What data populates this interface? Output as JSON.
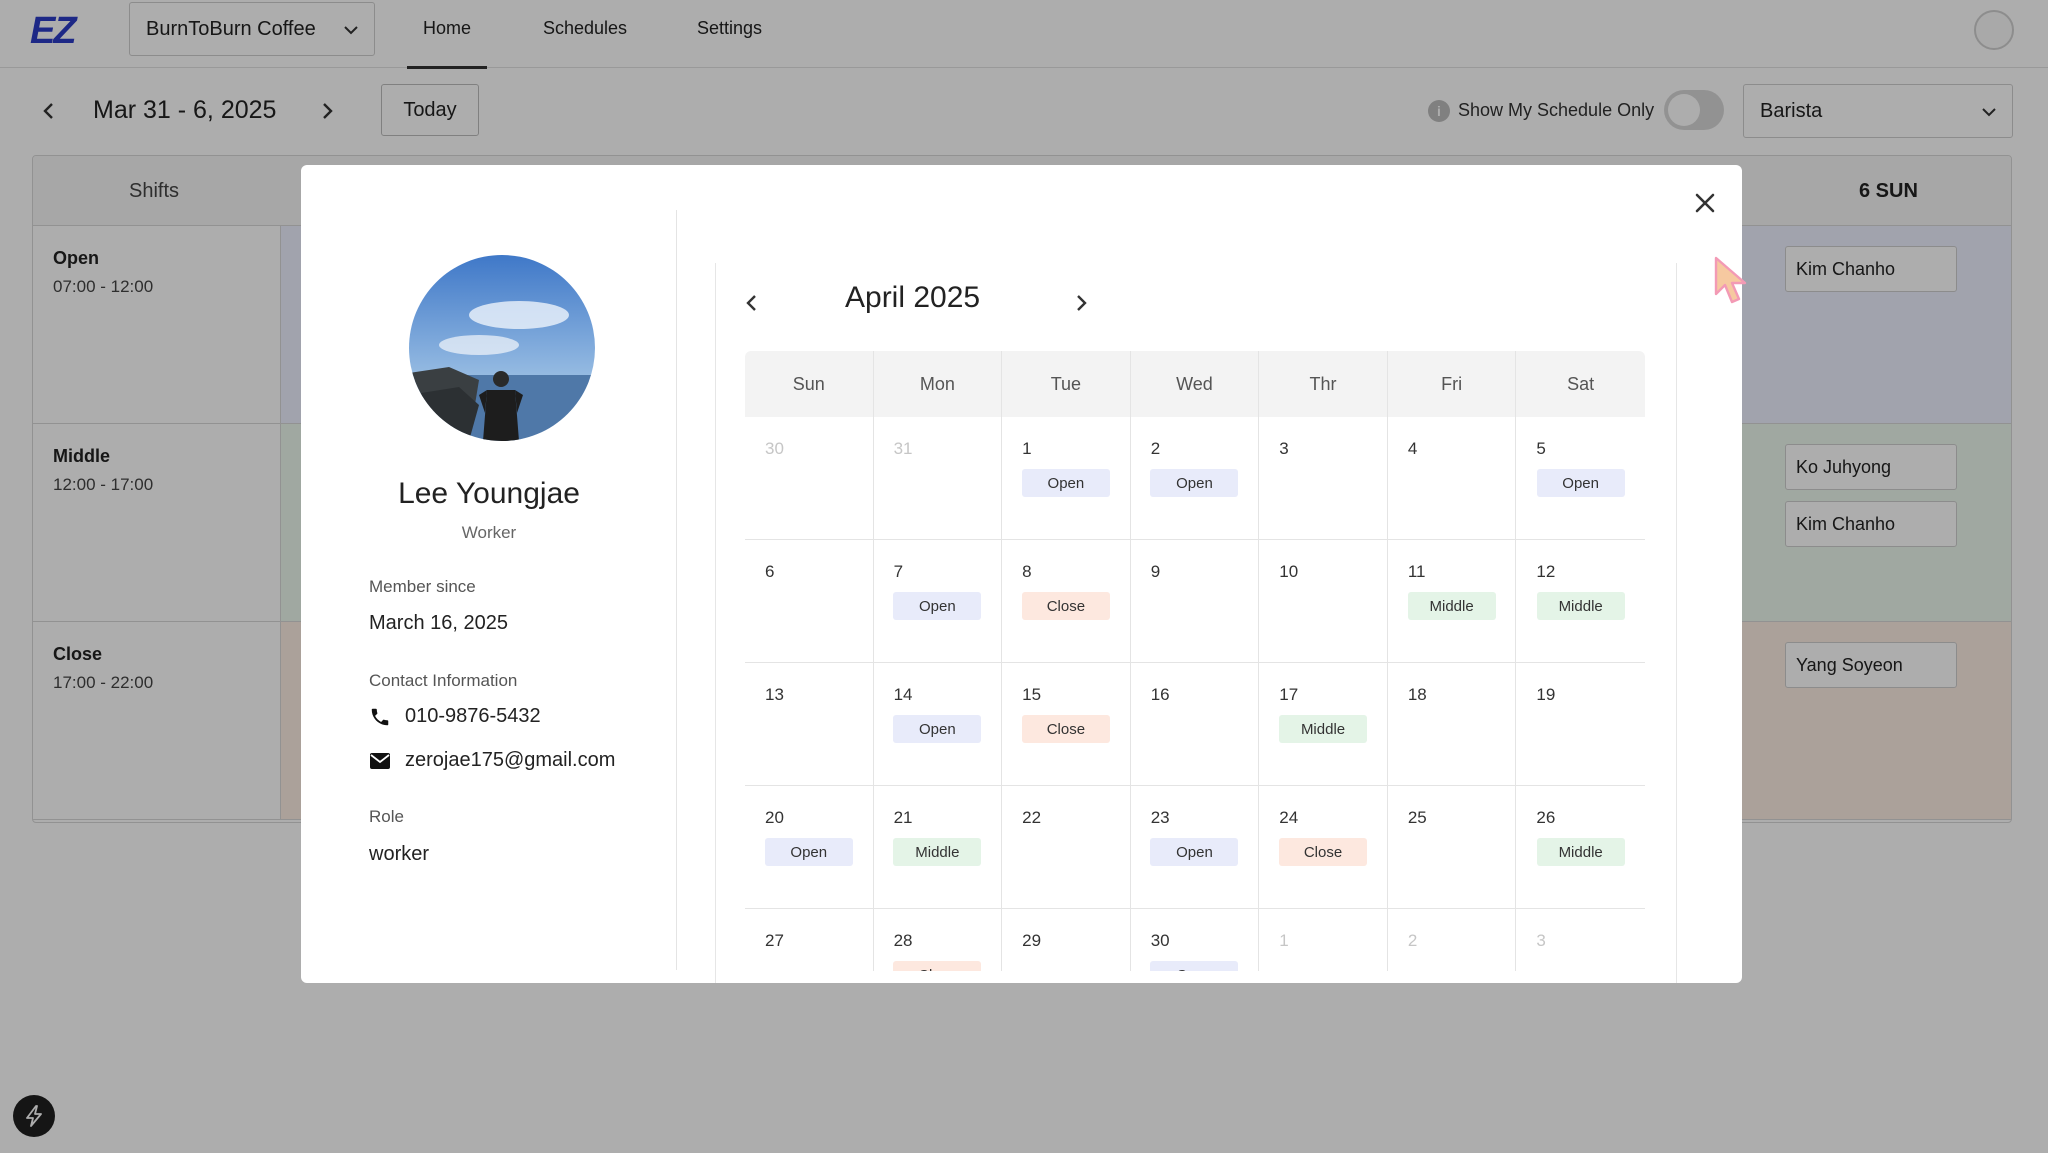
{
  "app": {
    "logo": "EZ",
    "store": "BurnToBurn Coffee",
    "nav": [
      "Home",
      "Schedules",
      "Settings"
    ]
  },
  "week": {
    "title": "Mar 31 - 6, 2025",
    "today_label": "Today",
    "show_my_schedule_label": "Show My Schedule Only",
    "info_glyph": "i",
    "role_filter": "Barista"
  },
  "grid": {
    "shifts_header": "Shifts",
    "day_header": "6 SUN",
    "shifts": [
      {
        "name": "Open",
        "time": "07:00 - 12:00",
        "type": "open"
      },
      {
        "name": "Middle",
        "time": "12:00 - 17:00",
        "type": "middle"
      },
      {
        "name": "Close",
        "time": "17:00 - 22:00",
        "type": "close"
      }
    ],
    "employees": {
      "open": [
        "Kim Chanho"
      ],
      "middle": [
        "Ko Juhyong",
        "Kim Chanho"
      ],
      "close": [
        "Yang Soyeon"
      ]
    }
  },
  "modal": {
    "profile": {
      "name": "Lee Youngjae",
      "title": "Worker",
      "member_since_label": "Member since",
      "member_since": "March 16, 2025",
      "contact_label": "Contact Information",
      "phone": "010-9876-5432",
      "email": "zerojae175@gmail.com",
      "role_label": "Role",
      "role": "worker"
    },
    "calendar": {
      "month": "April 2025",
      "weekdays": [
        "Sun",
        "Mon",
        "Tue",
        "Wed",
        "Thr",
        "Fri",
        "Sat"
      ],
      "weeks": [
        [
          {
            "d": "30",
            "m": true
          },
          {
            "d": "31",
            "m": true
          },
          {
            "d": "1",
            "s": "Open"
          },
          {
            "d": "2",
            "s": "Open"
          },
          {
            "d": "3"
          },
          {
            "d": "4"
          },
          {
            "d": "5",
            "s": "Open"
          }
        ],
        [
          {
            "d": "6"
          },
          {
            "d": "7",
            "s": "Open"
          },
          {
            "d": "8",
            "s": "Close"
          },
          {
            "d": "9"
          },
          {
            "d": "10"
          },
          {
            "d": "11",
            "s": "Middle"
          },
          {
            "d": "12",
            "s": "Middle"
          }
        ],
        [
          {
            "d": "13"
          },
          {
            "d": "14",
            "s": "Open"
          },
          {
            "d": "15",
            "s": "Close"
          },
          {
            "d": "16"
          },
          {
            "d": "17",
            "s": "Middle"
          },
          {
            "d": "18"
          },
          {
            "d": "19"
          }
        ],
        [
          {
            "d": "20",
            "s": "Open"
          },
          {
            "d": "21",
            "s": "Middle"
          },
          {
            "d": "22"
          },
          {
            "d": "23",
            "s": "Open"
          },
          {
            "d": "24",
            "s": "Close"
          },
          {
            "d": "25"
          },
          {
            "d": "26",
            "s": "Middle"
          }
        ],
        [
          {
            "d": "27"
          },
          {
            "d": "28",
            "s": "Close"
          },
          {
            "d": "29"
          },
          {
            "d": "30",
            "s": "Open"
          },
          {
            "d": "1",
            "m": true
          },
          {
            "d": "2",
            "m": true
          },
          {
            "d": "3",
            "m": true
          }
        ]
      ]
    }
  },
  "colors": {
    "brand": "#2c3cc6",
    "open": "#e8ebfa",
    "middle": "#e4f4e7",
    "close": "#fde8df"
  }
}
